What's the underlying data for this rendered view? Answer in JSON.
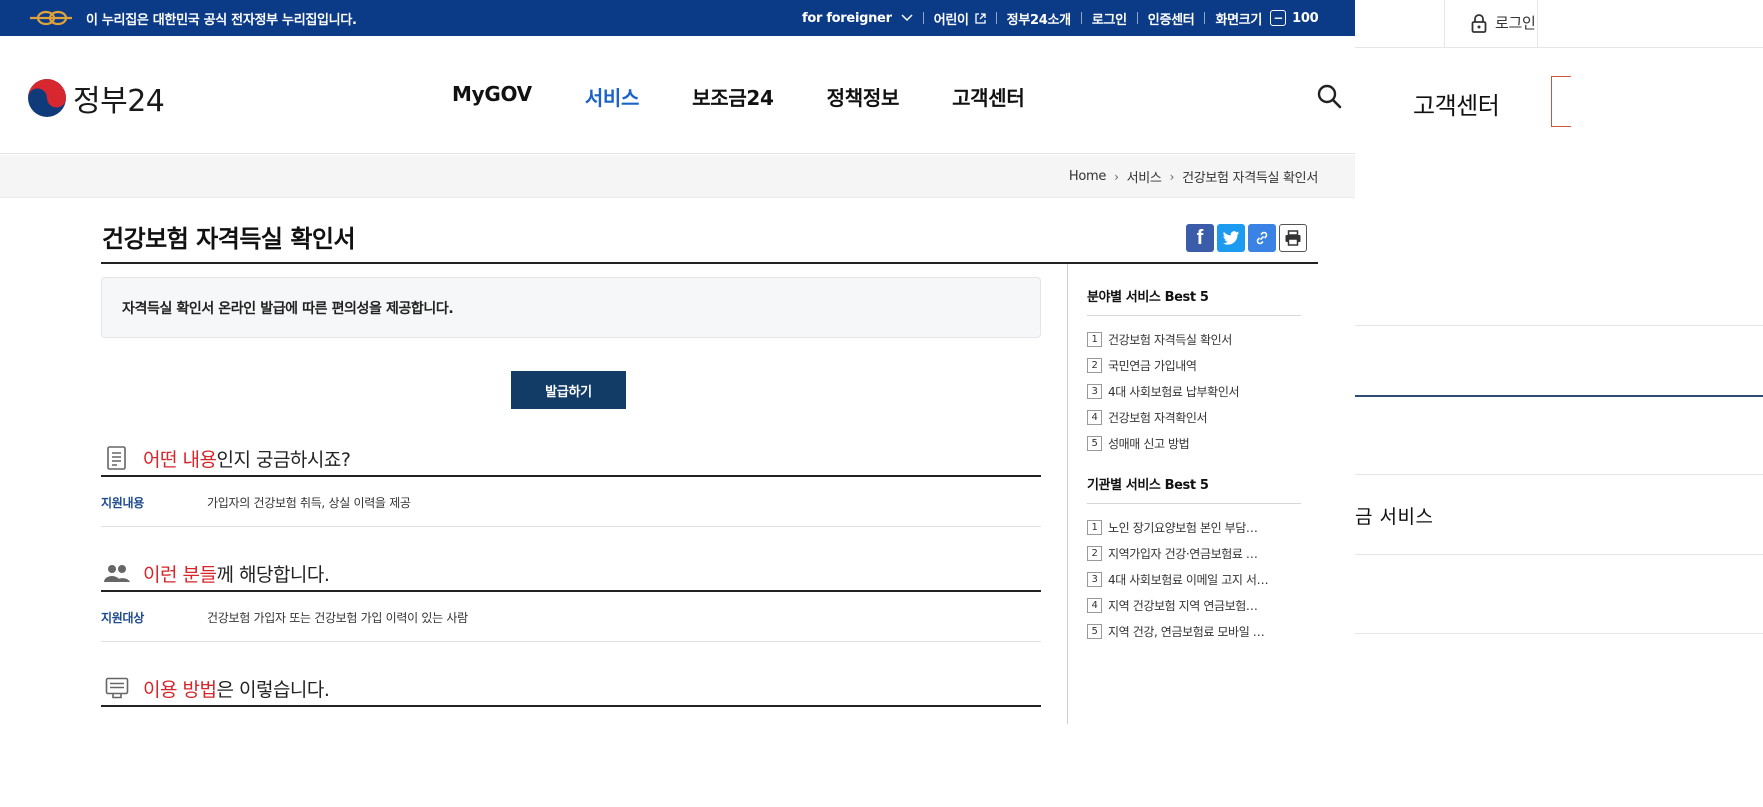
{
  "topbar": {
    "notice": "이 누리집은 대한민국 공식 전자정부 누리집입니다.",
    "links": {
      "foreigner": "for foreigner",
      "kids": "어린이",
      "about": "정부24소개",
      "login": "로그인",
      "cert": "인증센터",
      "screen_size": "화면크기",
      "zoom": "100"
    }
  },
  "header": {
    "logo_text": "정부24",
    "nav": [
      "MyGOV",
      "서비스",
      "보조금24",
      "정책정보",
      "고객센터"
    ],
    "active_nav": "서비스"
  },
  "breadcrumb": [
    "Home",
    "서비스",
    "건강보험 자격득실 확인서"
  ],
  "page": {
    "title": "건강보험 자격득실 확인서",
    "intro": "자격득실 확인서 온라인 발급에 따른 편의성을 제공합니다.",
    "issue_button": "발급하기"
  },
  "sections": [
    {
      "title_highlight": "어떤 내용",
      "title_rest": "인지 궁금하시죠?",
      "key": "지원내용",
      "value": "가입자의 건강보험 취득, 상실 이력을 제공"
    },
    {
      "title_highlight": "이런 분들",
      "title_rest": "께 해당합니다.",
      "key": "지원대상",
      "value": "건강보험 가입자 또는 건강보험 가입 이력이 있는 사람"
    },
    {
      "title_highlight": "이용 방법",
      "title_rest": "은 이렇습니다."
    }
  ],
  "aside": {
    "field_best": {
      "title": "분야별 서비스 Best 5",
      "items": [
        {
          "num": "1",
          "label": "건강보험 자격득실 확인서"
        },
        {
          "num": "2",
          "label": "국민연금 가입내역"
        },
        {
          "num": "3",
          "label": "4대 사회보험료 납부확인서"
        },
        {
          "num": "4",
          "label": "건강보험 자격확인서"
        },
        {
          "num": "5",
          "label": "성매매 신고 방법"
        }
      ]
    },
    "agency_best": {
      "title": "기관별 서비스 Best 5",
      "items": [
        {
          "num": "1",
          "label": "노인 장기요양보험 본인 부담…"
        },
        {
          "num": "2",
          "label": "지역가입자 건강·연금보험료 …"
        },
        {
          "num": "3",
          "label": "4대 사회보험료 이메일 고지 서…"
        },
        {
          "num": "4",
          "label": "지역 건강보험 지역 연금보험…"
        },
        {
          "num": "5",
          "label": "지역 건강, 연금보험료 모바일 …"
        }
      ]
    }
  },
  "side_panel": {
    "login": "로그인",
    "title": "고객센터",
    "service_partial": "금 서비스"
  },
  "colors": {
    "topbar": "#0b3a87",
    "nav_active": "#1b63c6",
    "highlight_red": "#d6262b",
    "button_navy": "#123b66",
    "key_blue": "#1e4b8f"
  }
}
